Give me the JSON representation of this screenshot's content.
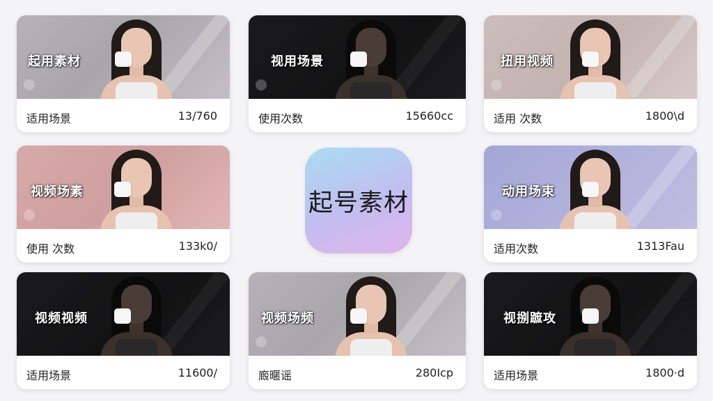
{
  "center_logo": {
    "text": "起号素材"
  },
  "cards": [
    {
      "title": "起用素材",
      "label": "适用场景",
      "value": "13/760"
    },
    {
      "title": "视用场景",
      "label": "使用次数",
      "value": "15660cc"
    },
    {
      "title": "扭用视频",
      "label": "适用 次数",
      "value": "1800\\d"
    },
    {
      "title": "视频场素",
      "label": "使用 次数",
      "value": "133k0/"
    },
    {
      "title": "动用场束",
      "label": "适用次数",
      "value": "1313Fau"
    },
    {
      "title": "视频视频",
      "label": "适用场景",
      "value": "11600/"
    },
    {
      "title": "视频场频",
      "label": "廄暱谣",
      "value": "280Icp"
    },
    {
      "title": "视捌蹠攻",
      "label": "适用场景",
      "value": "1800·d"
    }
  ],
  "icons": {
    "play_overlay": "play-placeholder-icon"
  },
  "colors": {
    "page_bg": "#f4f4f6",
    "logo_gradient_start": "#a8dcf1",
    "logo_gradient_end": "#e0b5ec"
  }
}
